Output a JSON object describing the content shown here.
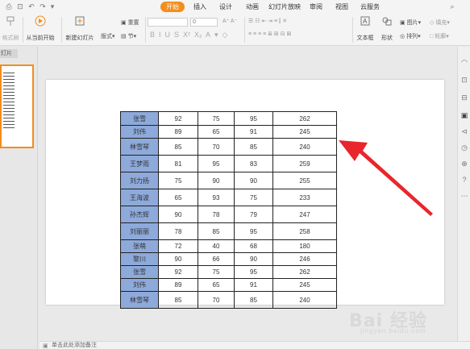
{
  "ribbon_tabs": [
    "开始",
    "插入",
    "设计",
    "动画",
    "幻灯片放映",
    "审阅",
    "视图",
    "云服务"
  ],
  "ribbon": {
    "format_painter": "格式刷",
    "from_current": "从当前开始",
    "new_slide": "新建幻灯片",
    "layout": "版式",
    "section": "节",
    "reset": "重置",
    "font_size": "0",
    "text_box": "文本框",
    "shape": "形状",
    "picture": "图片",
    "arrange": "排列",
    "fill": "填充",
    "outline": "轮廓"
  },
  "left_panel": {
    "tab_label": "灯片",
    "slide_number": "1"
  },
  "notes": {
    "placeholder": "单击此处添加备注"
  },
  "colors": {
    "accent": "#f38d1c",
    "name_cell": "#8eaadb",
    "arrow": "#e8262b"
  },
  "table": {
    "rows": [
      [
        "张雪",
        "92",
        "75",
        "95",
        "262"
      ],
      [
        "刘伟",
        "89",
        "65",
        "91",
        "245"
      ],
      [
        "林雪琴",
        "85",
        "70",
        "85",
        "240"
      ],
      [
        "王梦雨",
        "81",
        "95",
        "83",
        "259"
      ],
      [
        "刘力扬",
        "75",
        "90",
        "90",
        "255"
      ],
      [
        "王海波",
        "65",
        "93",
        "75",
        "233"
      ],
      [
        "孙杰辉",
        "90",
        "78",
        "79",
        "247"
      ],
      [
        "刘丽丽",
        "78",
        "85",
        "95",
        "258"
      ],
      [
        "张萌",
        "72",
        "40",
        "68",
        "180"
      ],
      [
        "黎川",
        "90",
        "66",
        "90",
        "246"
      ],
      [
        "张雪",
        "92",
        "75",
        "95",
        "262"
      ],
      [
        "刘伟",
        "89",
        "65",
        "91",
        "245"
      ],
      [
        "林雪琴",
        "85",
        "70",
        "85",
        "240"
      ]
    ]
  },
  "watermark": {
    "brand": "Bai 经验",
    "url": "jingyan.baidu.com"
  }
}
